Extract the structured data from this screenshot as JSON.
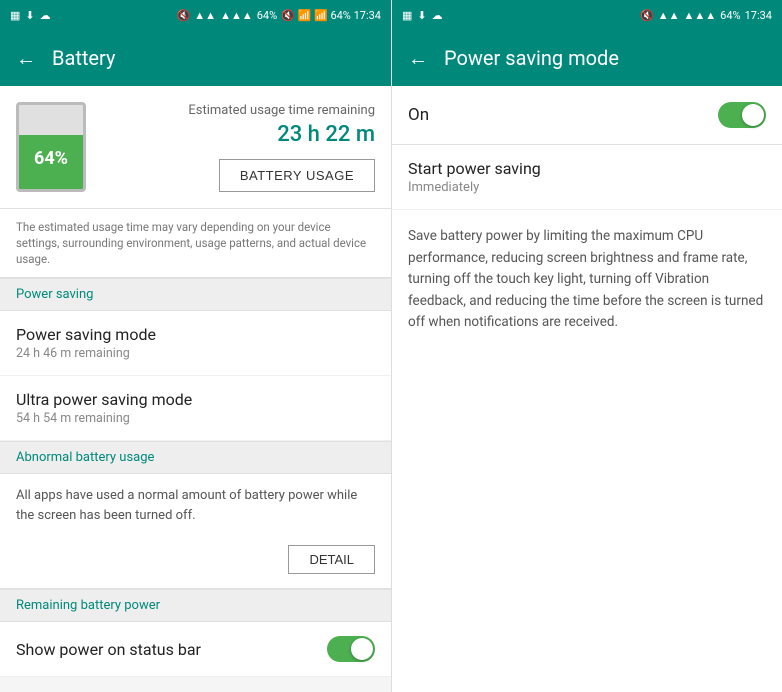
{
  "left": {
    "statusBar": {
      "icons": [
        "notification1",
        "notification2",
        "notification3"
      ],
      "rightIcons": "🔇 📶 📶 64% 17:34"
    },
    "header": {
      "back": "←",
      "title": "Battery"
    },
    "battery": {
      "percent": "64%",
      "fillHeight": "64",
      "estimatedLabel": "Estimated usage time remaining",
      "timeRemaining": "23 h 22 m",
      "usageButton": "BATTERY USAGE",
      "note": "The estimated usage time may vary depending on your device settings, surrounding environment, usage patterns, and actual device usage."
    },
    "sections": [
      {
        "header": "Power saving",
        "items": [
          {
            "title": "Power saving mode",
            "sub": "24 h 46 m remaining"
          },
          {
            "title": "Ultra power saving mode",
            "sub": "54 h 54 m remaining"
          }
        ]
      },
      {
        "header": "Abnormal battery usage",
        "text": "All apps have used a normal amount of battery power while the screen has been turned off.",
        "detailBtn": "DETAIL"
      },
      {
        "header": "Remaining battery power",
        "toggleLabel": "Show power on status bar",
        "toggleState": "on"
      }
    ]
  },
  "right": {
    "statusBar": {
      "rightIcons": "🔇 📶 📶 64% 17:34"
    },
    "header": {
      "back": "←",
      "title": "Power saving mode"
    },
    "onLabel": "On",
    "toggleState": "on",
    "startPower": {
      "title": "Start power saving",
      "sub": "Immediately"
    },
    "description": "Save battery power by limiting the maximum CPU performance, reducing screen brightness and frame rate, turning off the touch key light, turning off Vibration feedback, and reducing the time before the screen is turned off when notifications are received."
  }
}
